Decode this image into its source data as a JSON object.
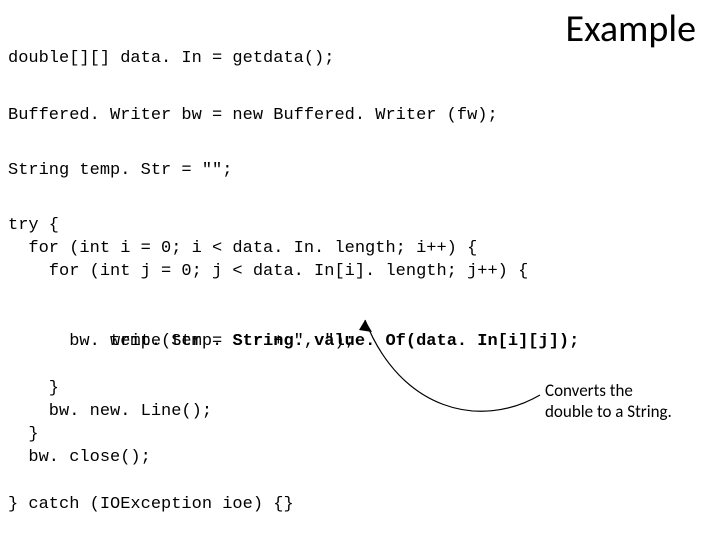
{
  "title": "Example",
  "code": {
    "l1": "double[][] data. In = getdata();",
    "l2": "Buffered. Writer bw = new Buffered. Writer (fw);",
    "l3": "String temp. Str = \"\";",
    "l4": "try {",
    "l5": "  for (int i = 0; i < data. In. length; i++) {",
    "l6": "    for (int j = 0; j < data. In[i]. length; j++) {",
    "l7a": "      temp. Str = ",
    "l7b": "String. value. Of(data. In[i][j]);",
    "l8": "      bw. write(temp. Str + \", \");",
    "l9": "    }",
    "l10": "    bw. new. Line();",
    "l11": "  }",
    "l12": "  bw. close();",
    "l13": "} catch (IOException ioe) {}"
  },
  "annotation": {
    "line1": "Converts the",
    "line2": "double to a String."
  }
}
